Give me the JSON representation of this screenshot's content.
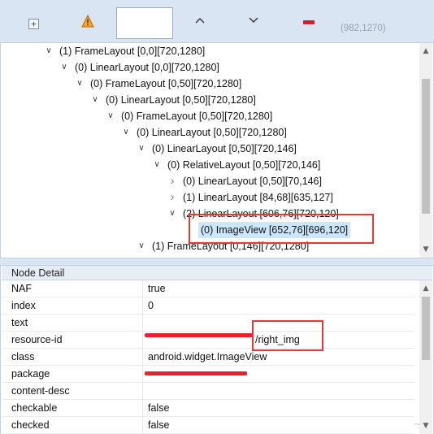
{
  "toolbar": {
    "expand_icon": "expand-all-icon",
    "warning_icon": "warning-triangle-icon",
    "coords": "(982,1270)"
  },
  "tree": {
    "nodes": [
      {
        "label": "(1) FrameLayout [0,0][720,1280]",
        "state": "expanded"
      },
      {
        "label": "(0) LinearLayout [0,0][720,1280]",
        "state": "expanded"
      },
      {
        "label": "(0) FrameLayout [0,50][720,1280]",
        "state": "expanded"
      },
      {
        "label": "(0) LinearLayout [0,50][720,1280]",
        "state": "expanded"
      },
      {
        "label": "(0) FrameLayout [0,50][720,1280]",
        "state": "expanded"
      },
      {
        "label": "(0) LinearLayout [0,50][720,1280]",
        "state": "expanded"
      },
      {
        "label": "(0) LinearLayout [0,50][720,146]",
        "state": "expanded"
      },
      {
        "label": "(0) RelativeLayout [0,50][720,146]",
        "state": "expanded"
      },
      {
        "label": "(0) LinearLayout [0,50][70,146]",
        "state": "collapsed"
      },
      {
        "label": "(1) LinearLayout [84,68][635,127]",
        "state": "collapsed"
      },
      {
        "label": "(2) LinearLayout [606,76][720,120]",
        "state": "expanded"
      },
      {
        "label": "(0) ImageView [652,76][696,120]",
        "state": "leaf",
        "selected": true
      },
      {
        "label": "(1) FrameLayout [0,146][720,1280]",
        "state": "expanded"
      }
    ]
  },
  "detail": {
    "title": "Node Detail",
    "rows": [
      {
        "key": "NAF",
        "value": "true"
      },
      {
        "key": "index",
        "value": "0"
      },
      {
        "key": "text",
        "value": ""
      },
      {
        "key": "resource-id",
        "value": "/right_img"
      },
      {
        "key": "class",
        "value": "android.widget.ImageView"
      },
      {
        "key": "package",
        "value": ""
      },
      {
        "key": "content-desc",
        "value": ""
      },
      {
        "key": "checkable",
        "value": "false"
      },
      {
        "key": "checked",
        "value": "false"
      }
    ]
  },
  "colors": {
    "toolbar_bg": "#d9e5f3",
    "selection": "#cce6fa",
    "annotation_red": "#e53935"
  }
}
